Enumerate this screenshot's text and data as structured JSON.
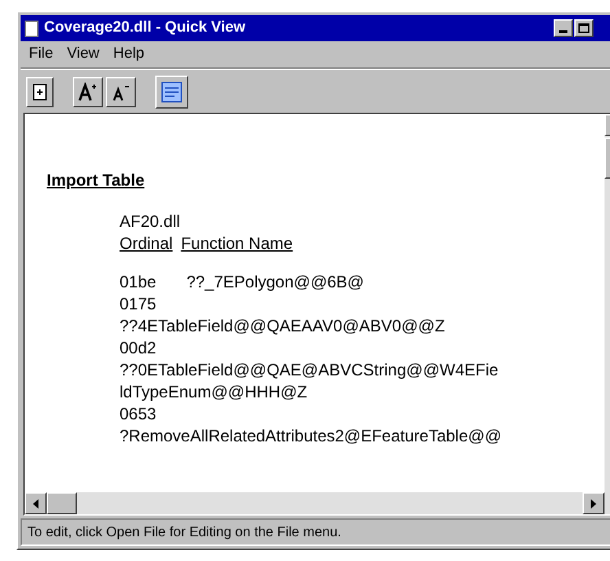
{
  "window": {
    "title": "Coverage20.dll - Quick View"
  },
  "menu": [
    "File",
    "View",
    "Help"
  ],
  "content": {
    "heading": "Import Table",
    "module": "AF20.dll",
    "columns": [
      "Ordinal",
      "Function Name"
    ],
    "entries": [
      {
        "kind": "inline",
        "ordinal": "01be",
        "lines": [
          "??_7EPolygon@@6B@"
        ]
      },
      {
        "kind": "stacked",
        "ordinal": "0175",
        "lines": [
          "??4ETableField@@QAEAAV0@ABV0@@Z"
        ]
      },
      {
        "kind": "stacked",
        "ordinal": "00d2",
        "lines": [
          "??0ETableField@@QAE@ABVCString@@W4EFie",
          "ldTypeEnum@@HHH@Z"
        ]
      },
      {
        "kind": "stacked",
        "ordinal": "0653",
        "lines": [
          "?RemoveAllRelatedAttributes2@EFeatureTable@@"
        ]
      }
    ]
  },
  "status_bar": "To edit, click Open File for Editing on the File menu."
}
